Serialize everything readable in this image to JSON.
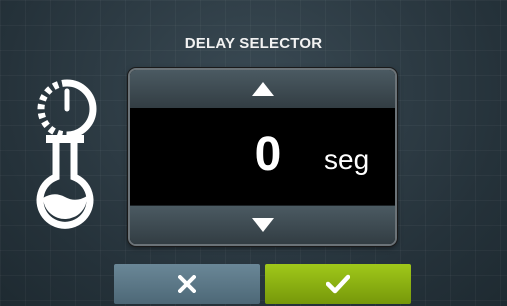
{
  "dialog": {
    "title": "DELAY SELECTOR"
  },
  "selector": {
    "value": "0",
    "unit": "seg"
  },
  "actions": {
    "cancel_icon": "close-icon",
    "confirm_icon": "check-icon"
  },
  "icons": [
    "timer-icon",
    "flask-icon",
    "triangle-up-icon",
    "triangle-down-icon"
  ],
  "colors": {
    "background": "#2c3a42",
    "cancel_button": "#5b7786",
    "confirm_button": "#8db512",
    "display": "#000000",
    "text": "#ffffff"
  }
}
